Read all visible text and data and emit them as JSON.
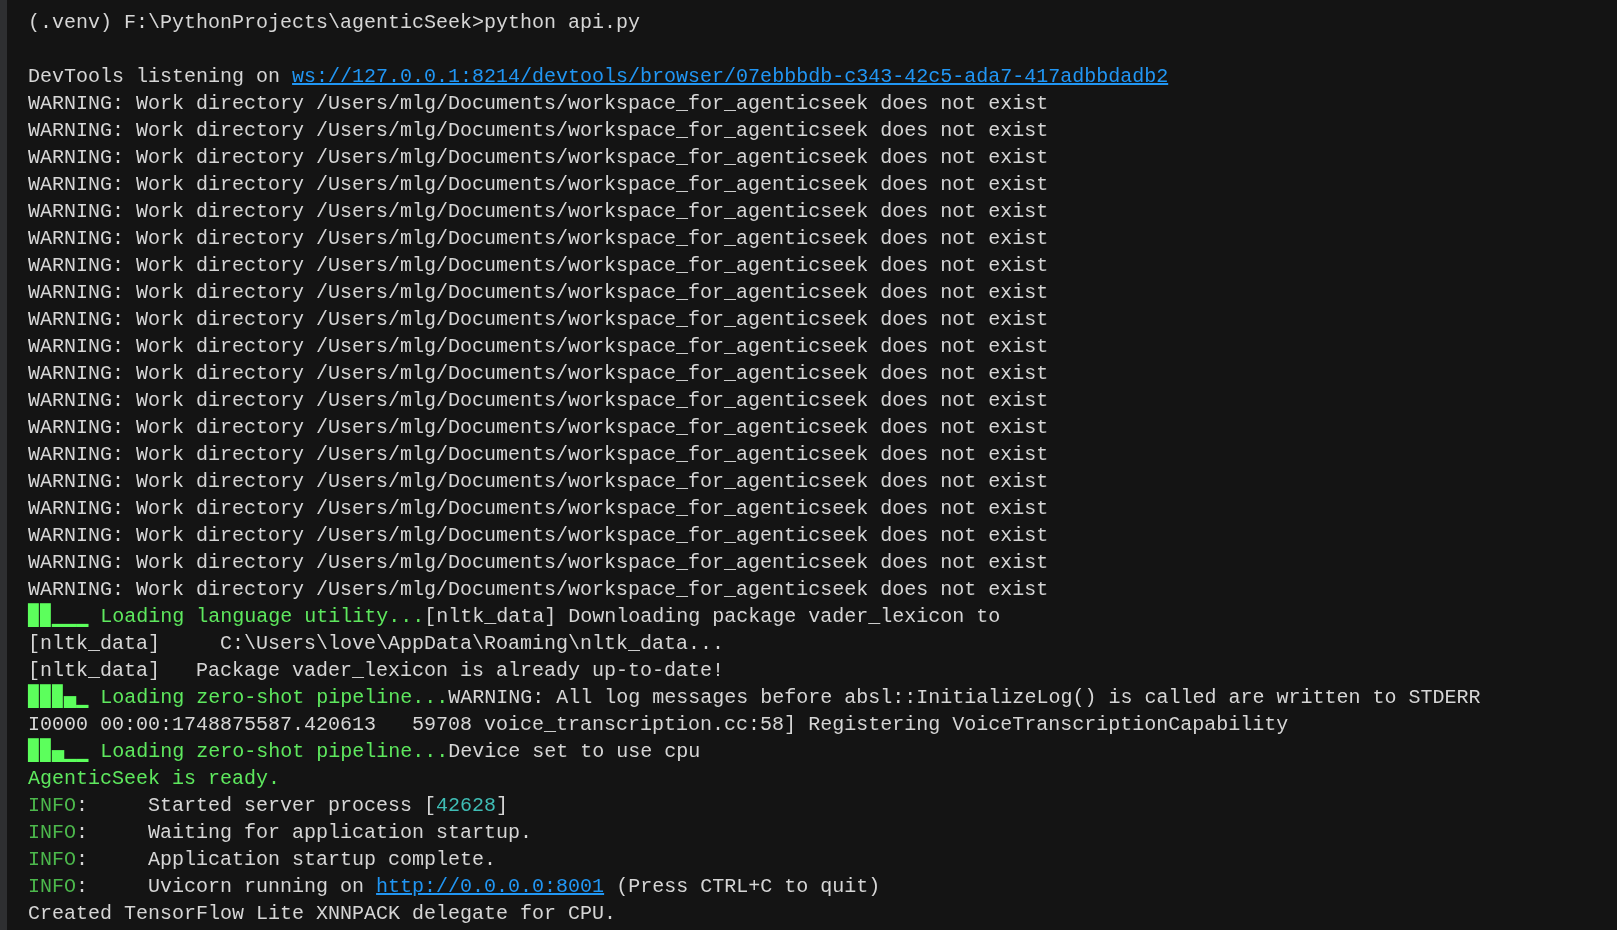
{
  "terminal": {
    "lines": [
      {
        "kind": "text",
        "segments": [
          {
            "kind": "plain",
            "text": "(.venv) F:\\PythonProjects\\agenticSeek>python api.py"
          }
        ]
      },
      {
        "kind": "blank"
      },
      {
        "kind": "text",
        "segments": [
          {
            "kind": "plain",
            "text": "DevTools listening on "
          },
          {
            "kind": "link",
            "text": "ws://127.0.0.1:8214/devtools/browser/07ebbbdb-c343-42c5-ada7-417adbbdadb2"
          }
        ]
      },
      {
        "kind": "text",
        "segments": [
          {
            "kind": "plain",
            "text": "WARNING: Work directory /Users/mlg/Documents/workspace_for_agenticseek does not exist"
          }
        ]
      },
      {
        "kind": "text",
        "segments": [
          {
            "kind": "plain",
            "text": "WARNING: Work directory /Users/mlg/Documents/workspace_for_agenticseek does not exist"
          }
        ]
      },
      {
        "kind": "text",
        "segments": [
          {
            "kind": "plain",
            "text": "WARNING: Work directory /Users/mlg/Documents/workspace_for_agenticseek does not exist"
          }
        ]
      },
      {
        "kind": "text",
        "segments": [
          {
            "kind": "plain",
            "text": "WARNING: Work directory /Users/mlg/Documents/workspace_for_agenticseek does not exist"
          }
        ]
      },
      {
        "kind": "text",
        "segments": [
          {
            "kind": "plain",
            "text": "WARNING: Work directory /Users/mlg/Documents/workspace_for_agenticseek does not exist"
          }
        ]
      },
      {
        "kind": "text",
        "segments": [
          {
            "kind": "plain",
            "text": "WARNING: Work directory /Users/mlg/Documents/workspace_for_agenticseek does not exist"
          }
        ]
      },
      {
        "kind": "text",
        "segments": [
          {
            "kind": "plain",
            "text": "WARNING: Work directory /Users/mlg/Documents/workspace_for_agenticseek does not exist"
          }
        ]
      },
      {
        "kind": "text",
        "segments": [
          {
            "kind": "plain",
            "text": "WARNING: Work directory /Users/mlg/Documents/workspace_for_agenticseek does not exist"
          }
        ]
      },
      {
        "kind": "text",
        "segments": [
          {
            "kind": "plain",
            "text": "WARNING: Work directory /Users/mlg/Documents/workspace_for_agenticseek does not exist"
          }
        ]
      },
      {
        "kind": "text",
        "segments": [
          {
            "kind": "plain",
            "text": "WARNING: Work directory /Users/mlg/Documents/workspace_for_agenticseek does not exist"
          }
        ]
      },
      {
        "kind": "text",
        "segments": [
          {
            "kind": "plain",
            "text": "WARNING: Work directory /Users/mlg/Documents/workspace_for_agenticseek does not exist"
          }
        ]
      },
      {
        "kind": "text",
        "segments": [
          {
            "kind": "plain",
            "text": "WARNING: Work directory /Users/mlg/Documents/workspace_for_agenticseek does not exist"
          }
        ]
      },
      {
        "kind": "text",
        "segments": [
          {
            "kind": "plain",
            "text": "WARNING: Work directory /Users/mlg/Documents/workspace_for_agenticseek does not exist"
          }
        ]
      },
      {
        "kind": "text",
        "segments": [
          {
            "kind": "plain",
            "text": "WARNING: Work directory /Users/mlg/Documents/workspace_for_agenticseek does not exist"
          }
        ]
      },
      {
        "kind": "text",
        "segments": [
          {
            "kind": "plain",
            "text": "WARNING: Work directory /Users/mlg/Documents/workspace_for_agenticseek does not exist"
          }
        ]
      },
      {
        "kind": "text",
        "segments": [
          {
            "kind": "plain",
            "text": "WARNING: Work directory /Users/mlg/Documents/workspace_for_agenticseek does not exist"
          }
        ]
      },
      {
        "kind": "text",
        "segments": [
          {
            "kind": "plain",
            "text": "WARNING: Work directory /Users/mlg/Documents/workspace_for_agenticseek does not exist"
          }
        ]
      },
      {
        "kind": "text",
        "segments": [
          {
            "kind": "plain",
            "text": "WARNING: Work directory /Users/mlg/Documents/workspace_for_agenticseek does not exist"
          }
        ]
      },
      {
        "kind": "text",
        "segments": [
          {
            "kind": "plain",
            "text": "WARNING: Work directory /Users/mlg/Documents/workspace_for_agenticseek does not exist"
          }
        ]
      },
      {
        "kind": "text",
        "segments": [
          {
            "kind": "spinner",
            "text": "▉▉▁▁▁"
          },
          {
            "kind": "green",
            "text": " Loading language utility..."
          },
          {
            "kind": "plain",
            "text": "[nltk_data] Downloading package vader_lexicon to"
          }
        ]
      },
      {
        "kind": "text",
        "segments": [
          {
            "kind": "plain",
            "text": "[nltk_data]     C:\\Users\\love\\AppData\\Roaming\\nltk_data..."
          }
        ]
      },
      {
        "kind": "text",
        "segments": [
          {
            "kind": "plain",
            "text": "[nltk_data]   Package vader_lexicon is already up-to-date!"
          }
        ]
      },
      {
        "kind": "text",
        "segments": [
          {
            "kind": "spinner",
            "text": "▉▉▉▄▁"
          },
          {
            "kind": "green",
            "text": " Loading zero-shot pipeline..."
          },
          {
            "kind": "plain",
            "text": "WARNING: All log messages before absl::InitializeLog() is called are written to STDERR"
          }
        ]
      },
      {
        "kind": "text",
        "segments": [
          {
            "kind": "plain",
            "text": "I0000 00:00:1748875587.420613   59708 voice_transcription.cc:58] Registering VoiceTranscriptionCapability"
          }
        ]
      },
      {
        "kind": "text",
        "segments": [
          {
            "kind": "spinner",
            "text": "▉▉▄▁▁"
          },
          {
            "kind": "green",
            "text": " Loading zero-shot pipeline..."
          },
          {
            "kind": "plain",
            "text": "Device set to use cpu"
          }
        ]
      },
      {
        "kind": "text",
        "segments": [
          {
            "kind": "green",
            "text": "AgenticSeek is ready."
          }
        ]
      },
      {
        "kind": "text",
        "segments": [
          {
            "kind": "info",
            "text": "INFO"
          },
          {
            "kind": "plain",
            "text": ":     Started server process ["
          },
          {
            "kind": "number",
            "text": "42628"
          },
          {
            "kind": "plain",
            "text": "]"
          }
        ]
      },
      {
        "kind": "text",
        "segments": [
          {
            "kind": "info",
            "text": "INFO"
          },
          {
            "kind": "plain",
            "text": ":     Waiting for application startup."
          }
        ]
      },
      {
        "kind": "text",
        "segments": [
          {
            "kind": "info",
            "text": "INFO"
          },
          {
            "kind": "plain",
            "text": ":     Application startup complete."
          }
        ]
      },
      {
        "kind": "text",
        "segments": [
          {
            "kind": "info",
            "text": "INFO"
          },
          {
            "kind": "plain",
            "text": ":     Uvicorn running on "
          },
          {
            "kind": "link",
            "text": "http://0.0.0.0:8001"
          },
          {
            "kind": "plain",
            "text": " (Press CTRL+C to quit)"
          }
        ]
      },
      {
        "kind": "text",
        "segments": [
          {
            "kind": "plain",
            "text": "Created TensorFlow Lite XNNPACK delegate for CPU."
          }
        ]
      }
    ]
  }
}
